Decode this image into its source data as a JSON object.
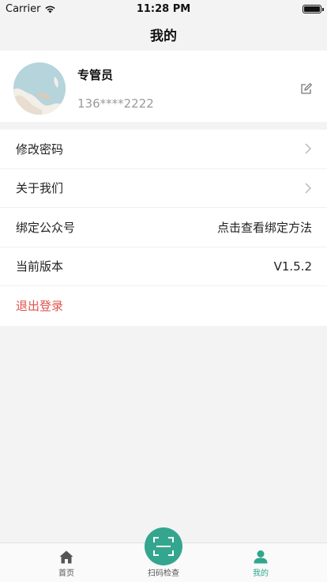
{
  "status_bar": {
    "carrier": "Carrier",
    "time": "11:28 PM"
  },
  "nav": {
    "title": "我的"
  },
  "profile": {
    "name": "专管员",
    "phone": "136****2222"
  },
  "menu": [
    {
      "label": "修改密码",
      "value": ""
    },
    {
      "label": "关于我们",
      "value": ""
    },
    {
      "label": "绑定公众号",
      "value": "点击查看绑定方法"
    },
    {
      "label": "当前版本",
      "value": "V1.5.2"
    },
    {
      "label": "退出登录",
      "value": ""
    }
  ],
  "tabs": [
    {
      "label": "首页",
      "icon": "home-icon"
    },
    {
      "label": "扫码检查",
      "icon": "scan-icon"
    },
    {
      "label": "我的",
      "icon": "person-icon"
    }
  ],
  "colors": {
    "accent": "#34a58e",
    "danger": "#e0524c",
    "background": "#f3f3f3"
  }
}
